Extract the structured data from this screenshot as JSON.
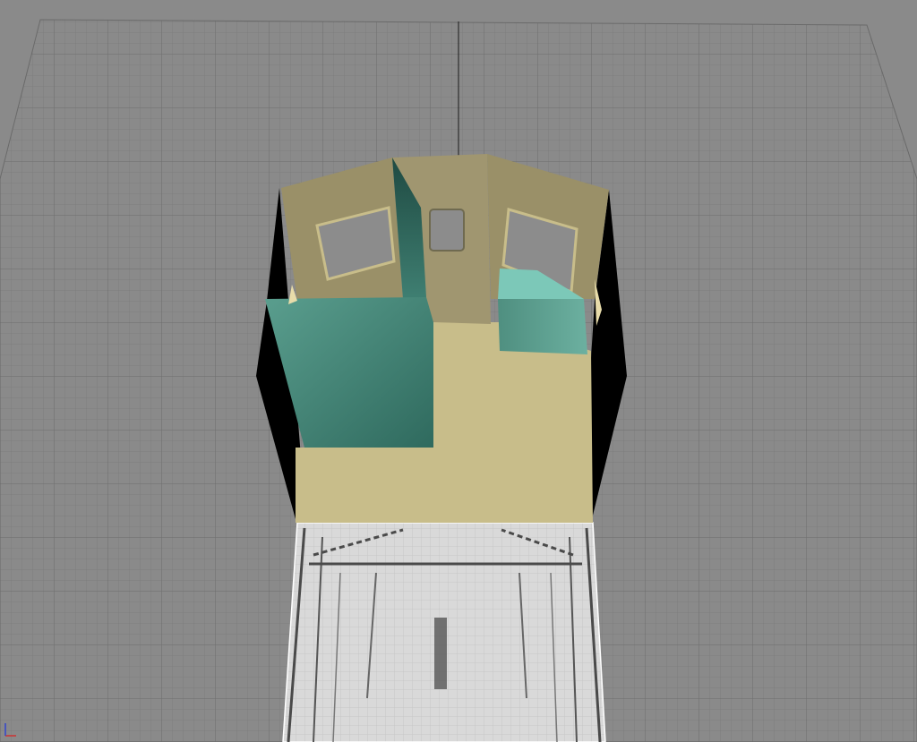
{
  "viewport": {
    "mode": "perspective",
    "background_color": "#8a8a8a",
    "grid": {
      "visible": true,
      "major_color": "#6f6f6f",
      "minor_color": "#7d7d7d",
      "axis_color": "#1a1a1a"
    },
    "model": {
      "floor_color": "#c8bd8a",
      "wall_color": "#9a9068",
      "wall_light_color": "#a8a07a",
      "partition_color": "#3f7f72",
      "partition_light_color": "#5a9e8e",
      "cabinet_top_color": "#7cc8b8",
      "outer_edge_color": "#000000"
    },
    "underlay": {
      "visible": true,
      "color": "#d9d9d9",
      "line_color": "#4a4a4a"
    },
    "axis_tripod": {
      "visible": true,
      "x_color": "#cc3333",
      "y_color": "#3344cc"
    }
  }
}
